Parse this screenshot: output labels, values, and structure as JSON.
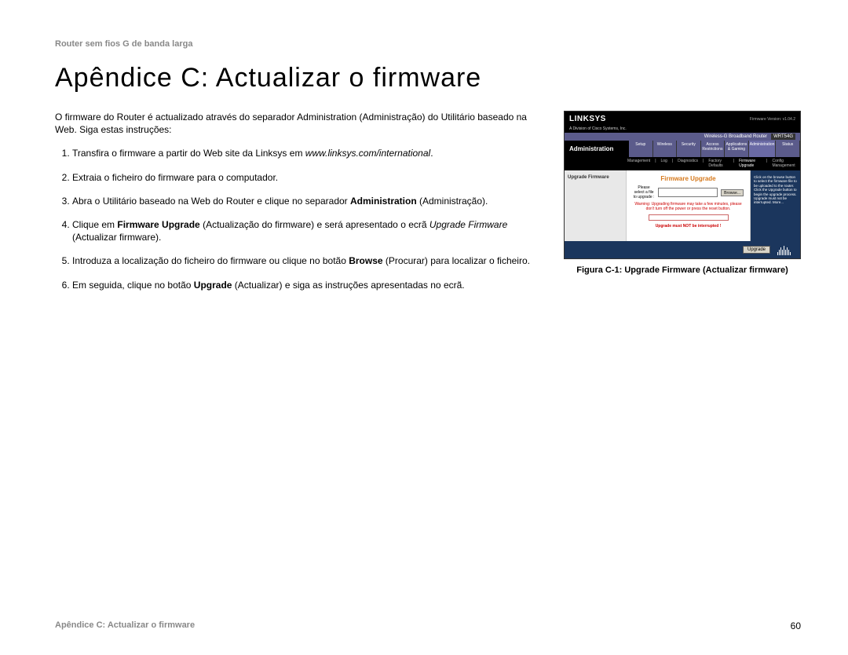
{
  "header_small": "Router sem fios G de banda larga",
  "title": "Apêndice C: Actualizar o firmware",
  "intro": "O firmware do Router é actualizado através do separador Administration (Administração) do Utilitário baseado na Web. Siga estas instruções:",
  "steps": {
    "s1_pre": "Transfira o firmware a partir do Web site da Linksys em ",
    "s1_link": "www.linksys.com/international",
    "s1_post": ".",
    "s2": "Extraia o ficheiro do firmware para o computador.",
    "s3_pre": "Abra o Utilitário baseado na Web do Router e clique no separador ",
    "s3_bold": "Administration",
    "s3_post": " (Administração).",
    "s4_pre": "Clique em ",
    "s4_bold": "Firmware Upgrade",
    "s4_mid": " (Actualização do firmware) e será apresentado o ecrã ",
    "s4_ital": "Upgrade Firmware",
    "s4_post": " (Actualizar firmware).",
    "s5_pre": "Introduza a localização do ficheiro do firmware ou clique no botão ",
    "s5_bold": "Browse",
    "s5_post": " (Procurar) para localizar o ficheiro.",
    "s6_pre": "Em seguida, clique no botão ",
    "s6_bold": "Upgrade",
    "s6_post": " (Actualizar) e siga as instruções apresentadas no ecrã."
  },
  "figure": {
    "caption": "Figura C-1: Upgrade Firmware (Actualizar firmware)",
    "logo": "LINKSYS",
    "logo_sub": "A Division of Cisco Systems, Inc.",
    "fw_version_label": "Firmware Version: v1.04.2",
    "model_desc": "Wireless-G Broadband Router",
    "model_no": "WRT54G",
    "active_tab_label": "Administration",
    "tabs": [
      "Setup",
      "Wireless",
      "Security",
      "Access Restrictions",
      "Applications & Gaming",
      "Administration",
      "Status"
    ],
    "subnav": [
      "Management",
      "Log",
      "Diagnostics",
      "Factory Defaults",
      "Firmware Upgrade",
      "Config Management"
    ],
    "subnav_active_index": 4,
    "left_label": "Upgrade Firmware",
    "panel_title": "Firmware Upgrade",
    "select_label": "Please select a file to upgrade :",
    "browse_btn": "Browse...",
    "warning": "Warning: Upgrading firmware may take a few minutes, please don't turn off the power or press the reset button.",
    "interrupt": "Upgrade must NOT be interrupted !",
    "right_help": "Click on the browse button to select the firmware file to be uploaded to the router.\n\nClick the Upgrade button to begin the upgrade process. Upgrade must not be interrupted.\nMore...",
    "upgrade_btn": "Upgrade"
  },
  "footer": {
    "left": "Apêndice C: Actualizar o firmware",
    "page": "60"
  }
}
